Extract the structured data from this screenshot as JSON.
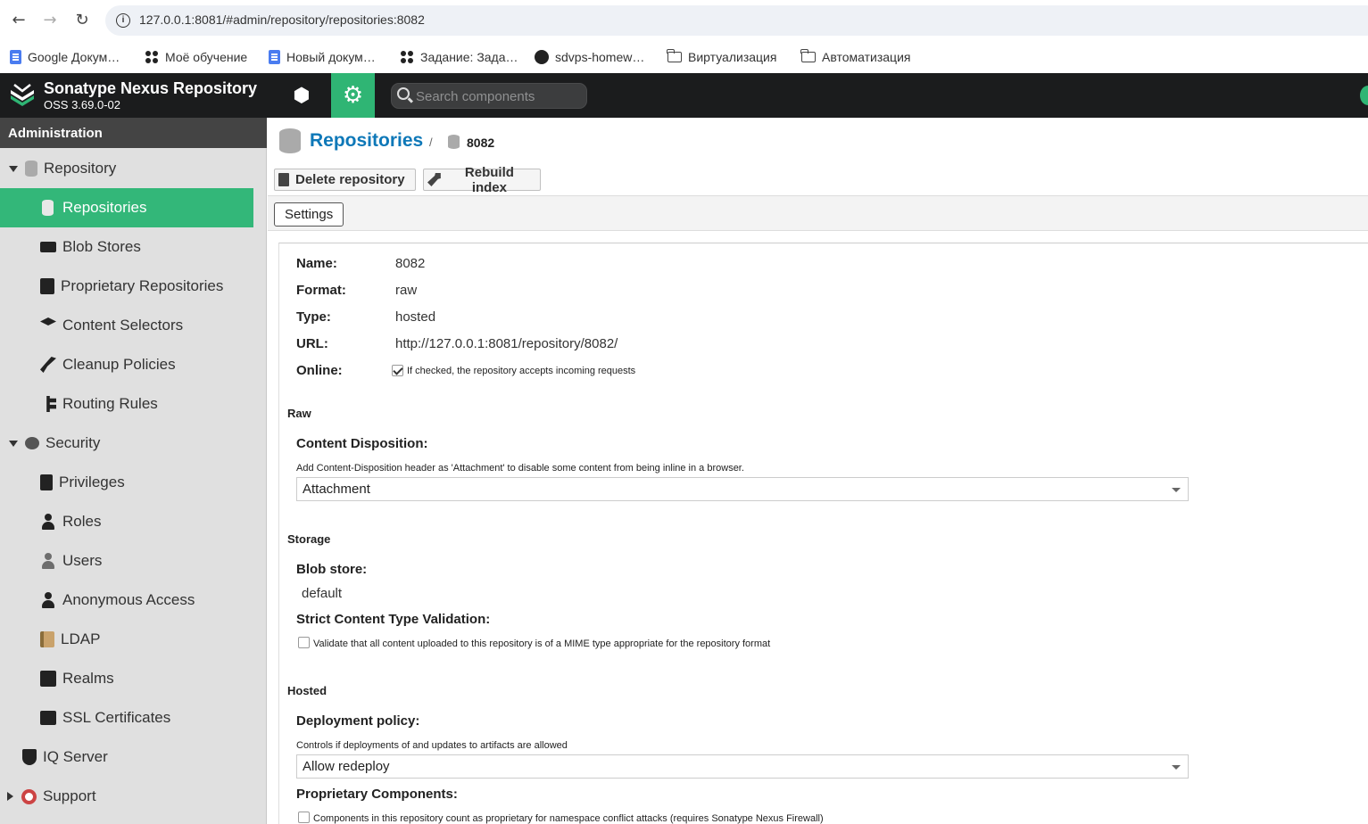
{
  "browser": {
    "url": "127.0.0.1:8081/#admin/repository/repositories:8082",
    "bookmarks": [
      {
        "label": "Google Докум…",
        "icon": "doc-icon"
      },
      {
        "label": "Моё обучение",
        "icon": "apps-icon"
      },
      {
        "label": "Новый докум…",
        "icon": "doc-icon"
      },
      {
        "label": "Задание: Зада…",
        "icon": "apps-icon"
      },
      {
        "label": "sdvps-homew…",
        "icon": "github-icon"
      },
      {
        "label": "Виртуализация",
        "icon": "folder-icon"
      },
      {
        "label": "Автоматизация",
        "icon": "folder-icon"
      }
    ]
  },
  "header": {
    "title": "Sonatype Nexus Repository",
    "version": "OSS 3.69.0-02",
    "search_placeholder": "Search components",
    "accent_color": "#2fb574"
  },
  "sidebar": {
    "heading": "Administration",
    "groups": {
      "repository": "Repository",
      "security": "Security"
    },
    "items": {
      "repositories": "Repositories",
      "blob_stores": "Blob Stores",
      "proprietary": "Proprietary Repositories",
      "content_selectors": "Content Selectors",
      "cleanup_policies": "Cleanup Policies",
      "routing_rules": "Routing Rules",
      "privileges": "Privileges",
      "roles": "Roles",
      "users": "Users",
      "anonymous_access": "Anonymous Access",
      "ldap": "LDAP",
      "realms": "Realms",
      "ssl_certificates": "SSL Certificates",
      "iq_server": "IQ Server",
      "support": "Support"
    },
    "active": "repositories"
  },
  "main": {
    "breadcrumb_root": "Repositories",
    "breadcrumb_sep": "/",
    "breadcrumb_current": "8082",
    "toolbar": {
      "delete": "Delete repository",
      "rebuild": "Rebuild index"
    },
    "tab": "Settings",
    "fields": {
      "name_label": "Name:",
      "name_value": "8082",
      "format_label": "Format:",
      "format_value": "raw",
      "type_label": "Type:",
      "type_value": "hosted",
      "url_label": "URL:",
      "url_value": "http://127.0.0.1:8081/repository/8082/",
      "online_label": "Online:",
      "online_hint": "If checked, the repository accepts incoming requests",
      "online_checked": true
    },
    "raw": {
      "section": "Raw",
      "disposition_label": "Content Disposition:",
      "disposition_hint": "Add Content-Disposition header as 'Attachment' to disable some content from being inline in a browser.",
      "disposition_value": "Attachment"
    },
    "storage": {
      "section": "Storage",
      "blob_label": "Blob store:",
      "blob_value": "default",
      "strict_label": "Strict Content Type Validation:",
      "strict_hint": "Validate that all content uploaded to this repository is of a MIME type appropriate for the repository format",
      "strict_checked": false
    },
    "hosted": {
      "section": "Hosted",
      "deploy_label": "Deployment policy:",
      "deploy_hint": "Controls if deployments of and updates to artifacts are allowed",
      "deploy_value": "Allow redeploy",
      "proprietary_label": "Proprietary Components:",
      "proprietary_hint": "Components in this repository count as proprietary for namespace conflict attacks (requires Sonatype Nexus Firewall)",
      "proprietary_checked": false
    }
  }
}
